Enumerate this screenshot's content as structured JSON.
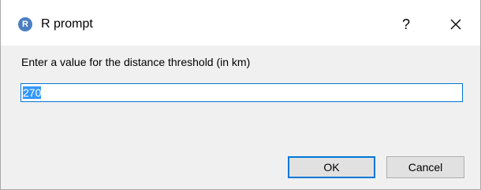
{
  "window": {
    "app_icon_letter": "R",
    "title": "R prompt",
    "help_label": "?",
    "close_icon": "close-icon"
  },
  "prompt": {
    "label": "Enter a value for the distance threshold (in km)",
    "value": "270"
  },
  "buttons": {
    "ok_label": "OK",
    "cancel_label": "Cancel"
  },
  "colors": {
    "focus_accent": "#0078d7",
    "selection": "#3399ff",
    "app_icon": "#4a7fc1"
  }
}
